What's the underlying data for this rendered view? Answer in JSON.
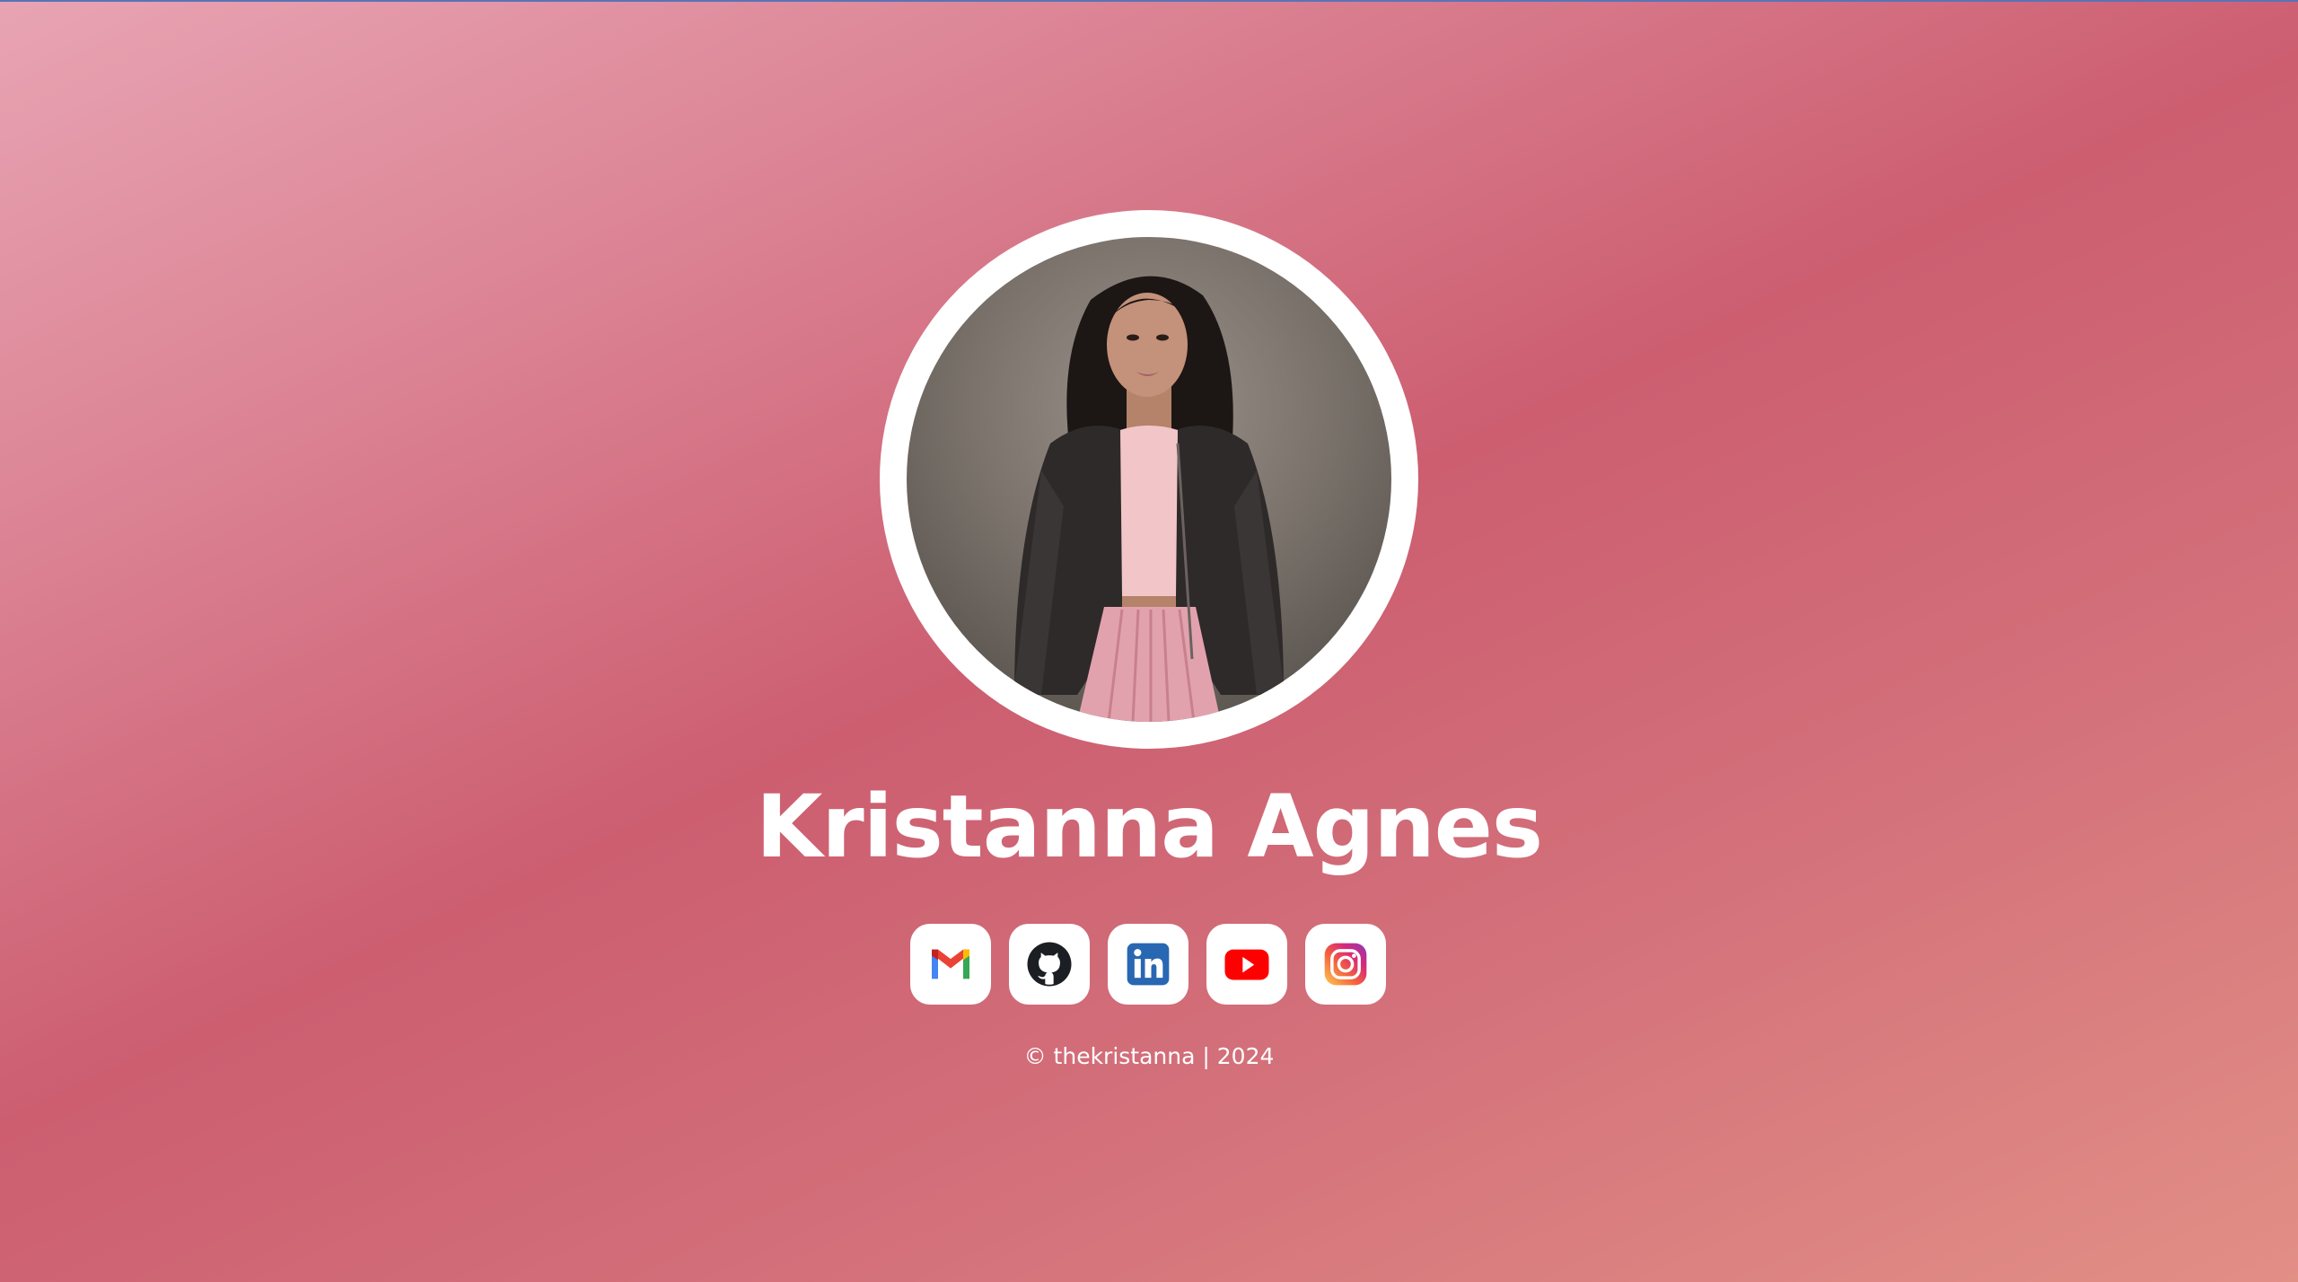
{
  "profile": {
    "name": "Kristanna Agnes",
    "avatar_alt": "profile-photo"
  },
  "socials": [
    {
      "name": "gmail",
      "icon": "gmail-icon"
    },
    {
      "name": "github",
      "icon": "github-icon"
    },
    {
      "name": "linkedin",
      "icon": "linkedin-icon"
    },
    {
      "name": "youtube",
      "icon": "youtube-icon"
    },
    {
      "name": "instagram",
      "icon": "instagram-icon"
    }
  ],
  "footer": {
    "text": "© thekristanna | 2024"
  },
  "colors": {
    "background_start": "#e8a4b3",
    "background_mid": "#cc5e70",
    "background_end": "#e28f86",
    "accent_line": "#5b73b8"
  }
}
